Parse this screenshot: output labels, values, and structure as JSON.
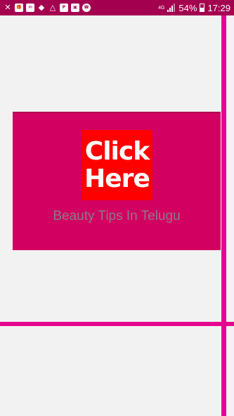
{
  "status_bar": {
    "notifications": [
      "app-icon",
      "gift-icon",
      "mail-icon",
      "security-icon",
      "drive-icon",
      "paytm-icon",
      "wallet-icon",
      "phone-icon"
    ],
    "network_label": "4G",
    "battery_percent": "54%",
    "battery_level": 0.54,
    "time": "17:29"
  },
  "banner": {
    "button_line1": "Click",
    "button_line2": "Here",
    "caption": "Beauty Tips In Telugu"
  },
  "colors": {
    "status_bar": "#a3004f",
    "accent_lines": "#e5068f",
    "banner_bg": "#d20061",
    "click_button": "#ff0000"
  }
}
